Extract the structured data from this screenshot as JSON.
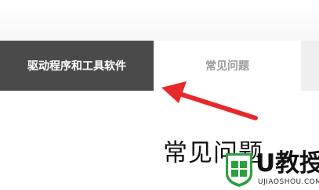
{
  "tabs": {
    "drivers_label": "驱动程序和工具软件",
    "faq_label": "常见问题"
  },
  "content": {
    "heading": "常见问题"
  },
  "watermark": {
    "brand_text": "U教授",
    "site_text": "UJIAOSHOU.COM"
  },
  "colors": {
    "active_tab_bg": "#4a4a4a",
    "annotation_arrow": "#e8292b",
    "logo_green": "#2e9f3e"
  }
}
